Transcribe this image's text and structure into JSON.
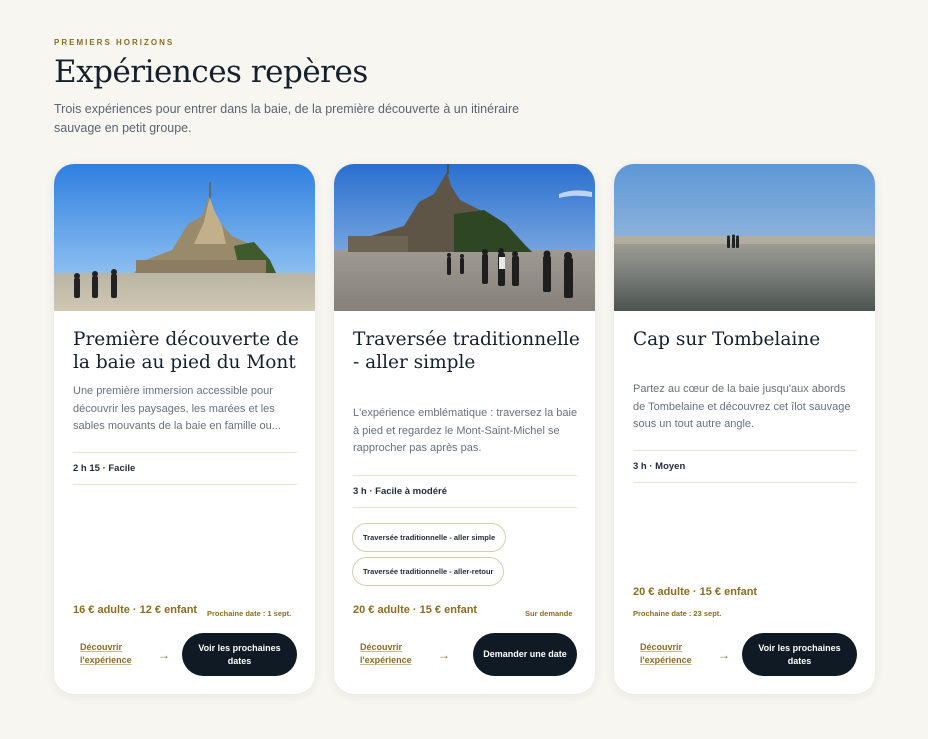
{
  "section": {
    "eyebrow": "PREMIERS HORIZONS",
    "title": "Expériences repères",
    "intro": "Trois expériences pour entrer dans la baie, de la première découverte à un itinéraire sauvage en petit groupe."
  },
  "colors": {
    "background": "#f8f6f1",
    "accent_gold": "#8a6d22",
    "cta_dark": "#0f1a24",
    "title_navy": "#14202b"
  },
  "cards": [
    {
      "title": "Première découverte de la baie au pied du Mont",
      "description": "Une première immersion accessible pour découvrir les paysages, les marées et les sables mouvants de la baie en famille ou...",
      "meta": "2 h 15 · Facile",
      "tags": [],
      "price": "16 € adulte · 12 € enfant",
      "next_date": "Prochaine date : 1 sept.",
      "discover_label": "Découvrir l'expérience",
      "arrow_icon": "arrow-right-icon",
      "cta_label": "Voir les prochaines dates",
      "image_icon": "mont-saint-michel-photo"
    },
    {
      "title": "Traversée traditionnelle - aller simple",
      "description": "L'expérience emblématique : traversez la baie à pied et regardez le Mont-Saint-Michel se rapprocher pas après pas.",
      "meta": "3 h · Facile à modéré",
      "tags": [
        "Traversée traditionnelle - aller simple",
        "Traversée traditionnelle - aller-retour"
      ],
      "price": "20 € adulte · 15 € enfant",
      "next_date": "Sur demande",
      "discover_label": "Découvrir l'expérience",
      "arrow_icon": "arrow-right-icon",
      "cta_label": "Demander une date",
      "image_icon": "mont-saint-michel-walkers-photo"
    },
    {
      "title": "Cap sur Tombelaine",
      "description": "Partez au cœur de la baie jusqu'aux abords de Tombelaine et découvrez cet îlot sauvage sous un tout autre angle.",
      "meta": "3 h · Moyen",
      "tags": [],
      "price": "20 € adulte · 15 € enfant",
      "next_date": "Prochaine date : 23 sept.",
      "discover_label": "Découvrir l'expérience",
      "arrow_icon": "arrow-right-icon",
      "cta_label": "Voir les prochaines dates",
      "image_icon": "bay-walkers-photo"
    }
  ]
}
